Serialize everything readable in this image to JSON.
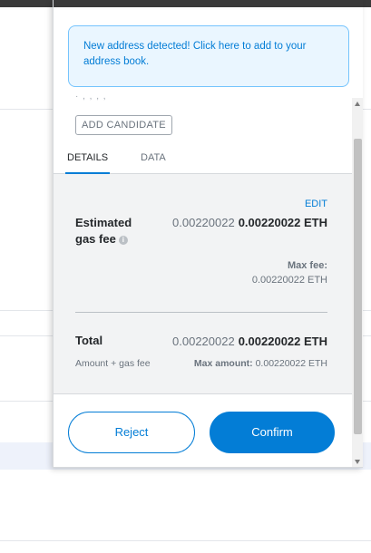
{
  "alert": {
    "text": "New address detected! Click here to add to your address book."
  },
  "faded_text": "· , , , ,",
  "add_candidate_label": "ADD CANDIDATE",
  "tabs": [
    {
      "label": "DETAILS",
      "active": true
    },
    {
      "label": "DATA",
      "active": false
    }
  ],
  "details": {
    "edit_label": "EDIT",
    "gas_fee": {
      "label": "Estimated gas fee",
      "info_icon": "info-icon",
      "value_secondary": "0.00220022",
      "value_primary": "0.00220022 ETH",
      "max_fee_label": "Max fee:",
      "max_fee_value": "0.00220022 ETH"
    },
    "total": {
      "label": "Total",
      "value_secondary": "0.00220022",
      "value_primary": "0.00220022 ETH",
      "sub_label": "Amount + gas fee",
      "max_amount_label": "Max amount:",
      "max_amount_value": "0.00220022 ETH"
    }
  },
  "buttons": {
    "reject": "Reject",
    "confirm": "Confirm"
  },
  "colors": {
    "primary": "#037dd6",
    "alert_bg": "#eaf6ff",
    "content_bg": "#f2f3f4"
  }
}
